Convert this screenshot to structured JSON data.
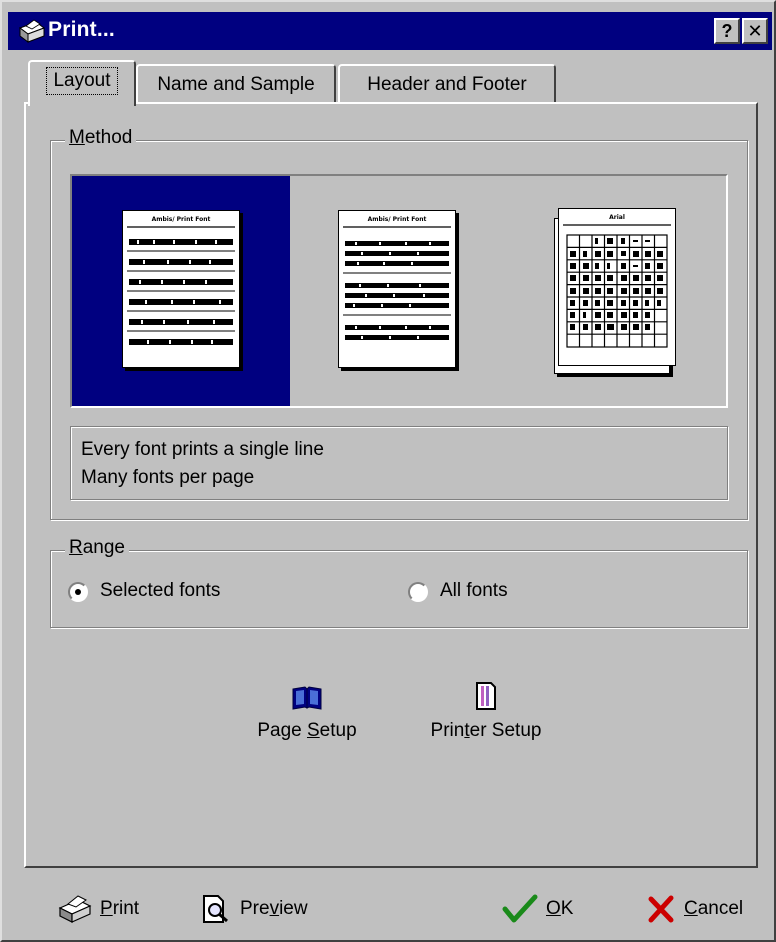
{
  "window": {
    "title": "Print...",
    "help_label": "?",
    "close_label": "✕"
  },
  "tabs": [
    {
      "label": "Layout",
      "active": true
    },
    {
      "label": "Name and Sample",
      "active": false
    },
    {
      "label": "Header and Footer",
      "active": false
    }
  ],
  "method": {
    "legend_prefix": "M",
    "legend_rest": "ethod",
    "options": [
      {
        "name": "single-line-per-font",
        "selected": true,
        "header": "Ambis/ Print Font"
      },
      {
        "name": "many-lines-per-font",
        "selected": false,
        "header": "Ambis/ Print Font"
      },
      {
        "name": "character-table",
        "selected": false,
        "header": "Arial"
      }
    ],
    "description_line1": "Every font prints a single line",
    "description_line2": "Many fonts per page"
  },
  "range": {
    "legend_prefix": "R",
    "legend_rest": "ange",
    "selected_label": "Selected fonts",
    "all_label": "All fonts",
    "selected_value": "selected"
  },
  "setup": {
    "page_setup_pre": "Page ",
    "page_setup_ul": "S",
    "page_setup_post": "etup",
    "printer_setup_pre": "Prin",
    "printer_setup_ul": "t",
    "printer_setup_post": "er Setup"
  },
  "buttons": {
    "print_ul": "P",
    "print_rest": "rint",
    "preview_pre": "Pre",
    "preview_ul": "v",
    "preview_post": "iew",
    "ok_ul": "O",
    "ok_rest": "K",
    "cancel_ul": "C",
    "cancel_rest": "ancel"
  },
  "colors": {
    "titlebar": "#000080",
    "face": "#c0c0c0",
    "selection": "#000080",
    "ok_check": "#1a8a1a",
    "cancel_x": "#cc0000"
  }
}
